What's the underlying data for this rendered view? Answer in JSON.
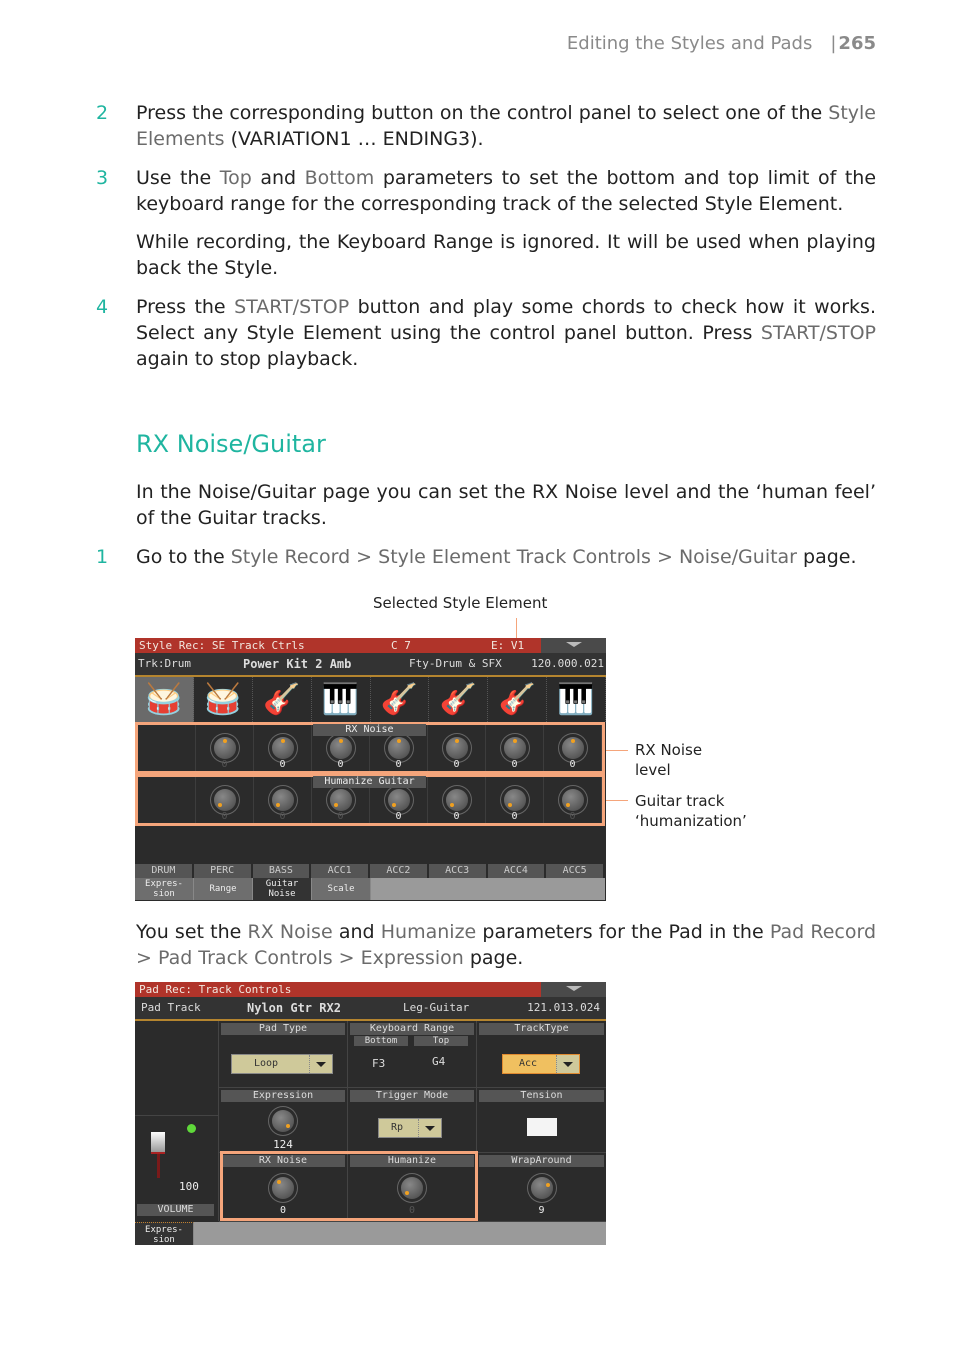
{
  "header": {
    "section": "Editing the Styles and Pads",
    "page": "265"
  },
  "steps_top": [
    {
      "num": "2",
      "parts": [
        [
          "Press the corresponding button on the control panel to select one of the ",
          false
        ],
        [
          "Style Elements",
          true
        ],
        [
          " (VARIATION1 … ENDING3).",
          false
        ]
      ]
    },
    {
      "num": "3",
      "parts": [
        [
          "Use the ",
          false
        ],
        [
          "Top",
          true
        ],
        [
          " and ",
          false
        ],
        [
          "Bottom",
          true
        ],
        [
          " parameters to set the bottom and top limit of the keyboard range for the corresponding track of the selected Style Element.",
          false
        ]
      ]
    },
    {
      "num": "4",
      "parts": [
        [
          "Press the ",
          false
        ],
        [
          "START/STOP",
          true
        ],
        [
          " button and play some chords to check how it works. Select any Style Element using the control panel button. Press ",
          false
        ],
        [
          "START/STOP",
          true
        ],
        [
          " again to stop playback.",
          false
        ]
      ]
    }
  ],
  "note_text": "While recording, the Keyboard Range is ignored. It will be used when playing back the Style.",
  "section_title": "RX Noise/Guitar",
  "intro_text": "In the Noise/Guitar page you can set the RX Noise level and the ‘human feel’ of the Guitar tracks.",
  "step1": {
    "num": "1",
    "parts": [
      [
        "Go to the ",
        false
      ],
      [
        "Style Record > Style Element Track Controls > Noise/Guitar",
        true
      ],
      [
        " page.",
        false
      ]
    ]
  },
  "pad_text": {
    "parts": [
      [
        "You set the ",
        false
      ],
      [
        "RX Noise",
        true
      ],
      [
        " and ",
        false
      ],
      [
        "Humanize",
        true
      ],
      [
        " parameters for the Pad in the ",
        false
      ],
      [
        "Pad Record > Pad Track Controls > Expression",
        true
      ],
      [
        " page.",
        false
      ]
    ]
  },
  "captions": {
    "selected_style_element": "Selected Style Element",
    "rx_noise": "RX Noise level",
    "guitar_track": "Guitar track ‘humanization’"
  },
  "screen1": {
    "title": "Style Rec: SE Track Ctrls",
    "note": "C 7",
    "element": "E: V1",
    "track_label": "Trk:Drum",
    "sound": "Power Kit 2 Amb",
    "category": "Fty-Drum & SFX",
    "program": "120.000.021",
    "instrument_icons": [
      "drum-kit-icon",
      "drum-kit-icon",
      "electric-guitar-icon",
      "keyboard-stand-icon",
      "acoustic-guitar-icon",
      "acoustic-guitar-icon",
      "acoustic-guitar-icon",
      "piano-icon"
    ],
    "rx_noise_label": "RX Noise",
    "rx_noise_values": [
      "0",
      "0",
      "0",
      "0",
      "0",
      "0",
      "0"
    ],
    "rx_noise_enabled": [
      false,
      true,
      true,
      true,
      true,
      true,
      true
    ],
    "humanize_label": "Humanize Guitar",
    "humanize_values": [
      "0",
      "0",
      "0",
      "0",
      "0",
      "0",
      "0"
    ],
    "humanize_enabled": [
      false,
      false,
      false,
      true,
      true,
      true,
      false
    ],
    "tracks": [
      "DRUM",
      "PERC",
      "BASS",
      "ACC1",
      "ACC2",
      "ACC3",
      "ACC4",
      "ACC5"
    ],
    "tabs": [
      "Expres-\nsion",
      "Range",
      "Guitar\nNoise",
      "Scale"
    ],
    "selected_tab": 2
  },
  "screen2": {
    "title": "Pad Rec: Track Controls",
    "track_label": "Pad Track",
    "sound": "Nylon Gtr RX2",
    "category": "Leg-Guitar",
    "program": "121.013.024",
    "pad_type": {
      "label": "Pad Type",
      "value": "Loop"
    },
    "keyboard_range": {
      "label": "Keyboard Range",
      "bottom_label": "Bottom",
      "top_label": "Top",
      "bottom": "F3",
      "top": "G4"
    },
    "track_type": {
      "label": "TrackType",
      "value": "Acc"
    },
    "expression": {
      "label": "Expression",
      "value": "124"
    },
    "trigger_mode": {
      "label": "Trigger Mode",
      "value": "Rp"
    },
    "tension": {
      "label": "Tension"
    },
    "rx_noise": {
      "label": "RX Noise",
      "value": "0"
    },
    "humanize": {
      "label": "Humanize",
      "value": "0"
    },
    "wraparound": {
      "label": "WrapAround",
      "value": "9"
    },
    "volume": {
      "label": "VOLUME",
      "value": "100"
    },
    "tab": "Expres-\nsion"
  }
}
